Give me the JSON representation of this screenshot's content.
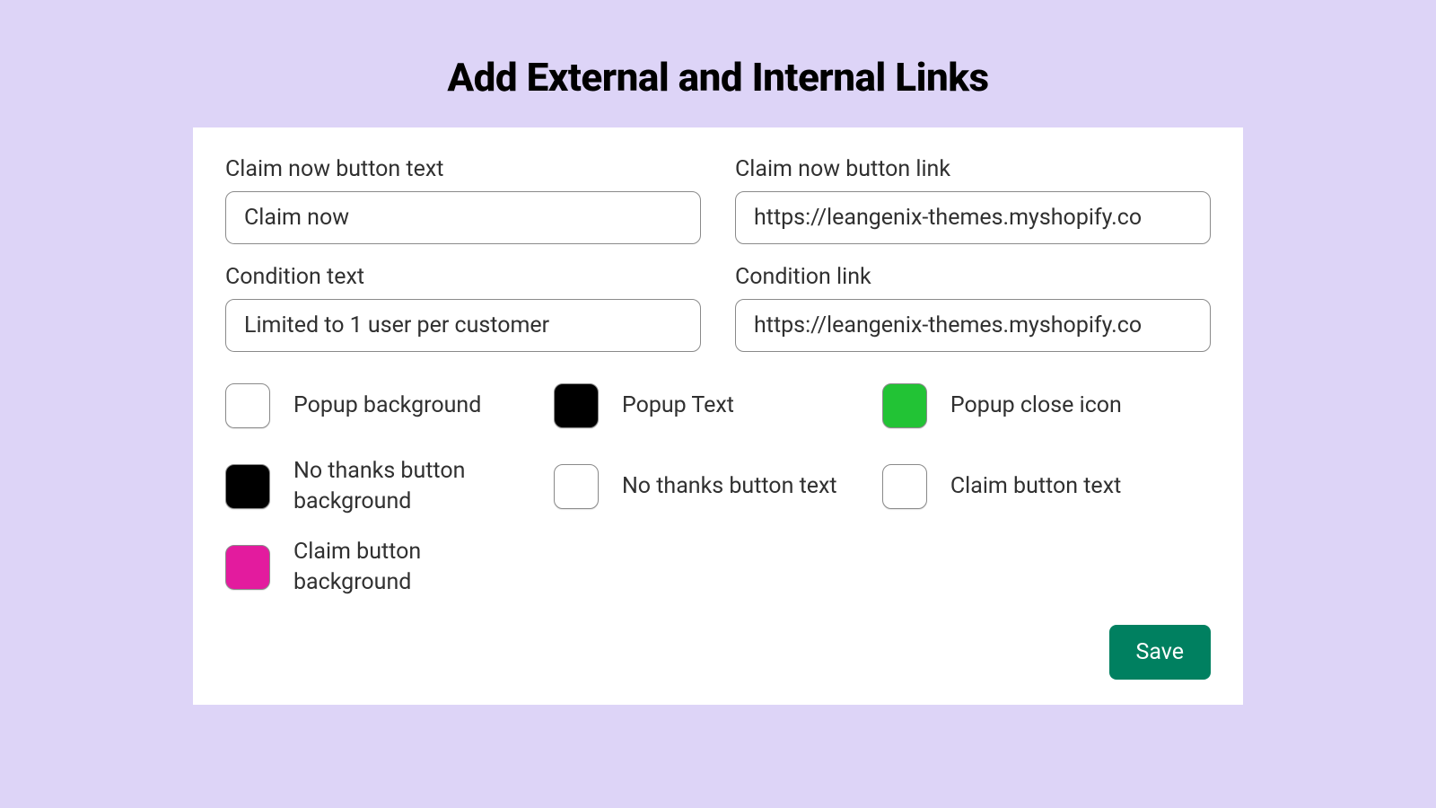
{
  "title": "Add External and Internal Links",
  "fields": {
    "claim_text": {
      "label": "Claim now button text",
      "value": "Claim now"
    },
    "claim_link": {
      "label": "Claim now button link",
      "value": "https://leangenix-themes.myshopify.co"
    },
    "condition_text": {
      "label": "Condition text",
      "value": "Limited to 1 user per customer"
    },
    "condition_link": {
      "label": "Condition link",
      "value": "https://leangenix-themes.myshopify.co"
    }
  },
  "swatches": {
    "popup_bg": {
      "label": "Popup background",
      "color": "#FFFFFF"
    },
    "popup_text": {
      "label": "Popup Text",
      "color": "#000000"
    },
    "popup_close": {
      "label": "Popup close icon",
      "color": "#22C335"
    },
    "no_thanks_bg": {
      "label": "No thanks button background",
      "color": "#000000"
    },
    "no_thanks_text": {
      "label": "No thanks button text",
      "color": "#FFFFFF"
    },
    "claim_btn_text": {
      "label": "Claim button text",
      "color": "#FFFFFF"
    },
    "claim_btn_bg": {
      "label": "Claim button background",
      "color": "#E31B9E"
    }
  },
  "actions": {
    "save": "Save"
  }
}
